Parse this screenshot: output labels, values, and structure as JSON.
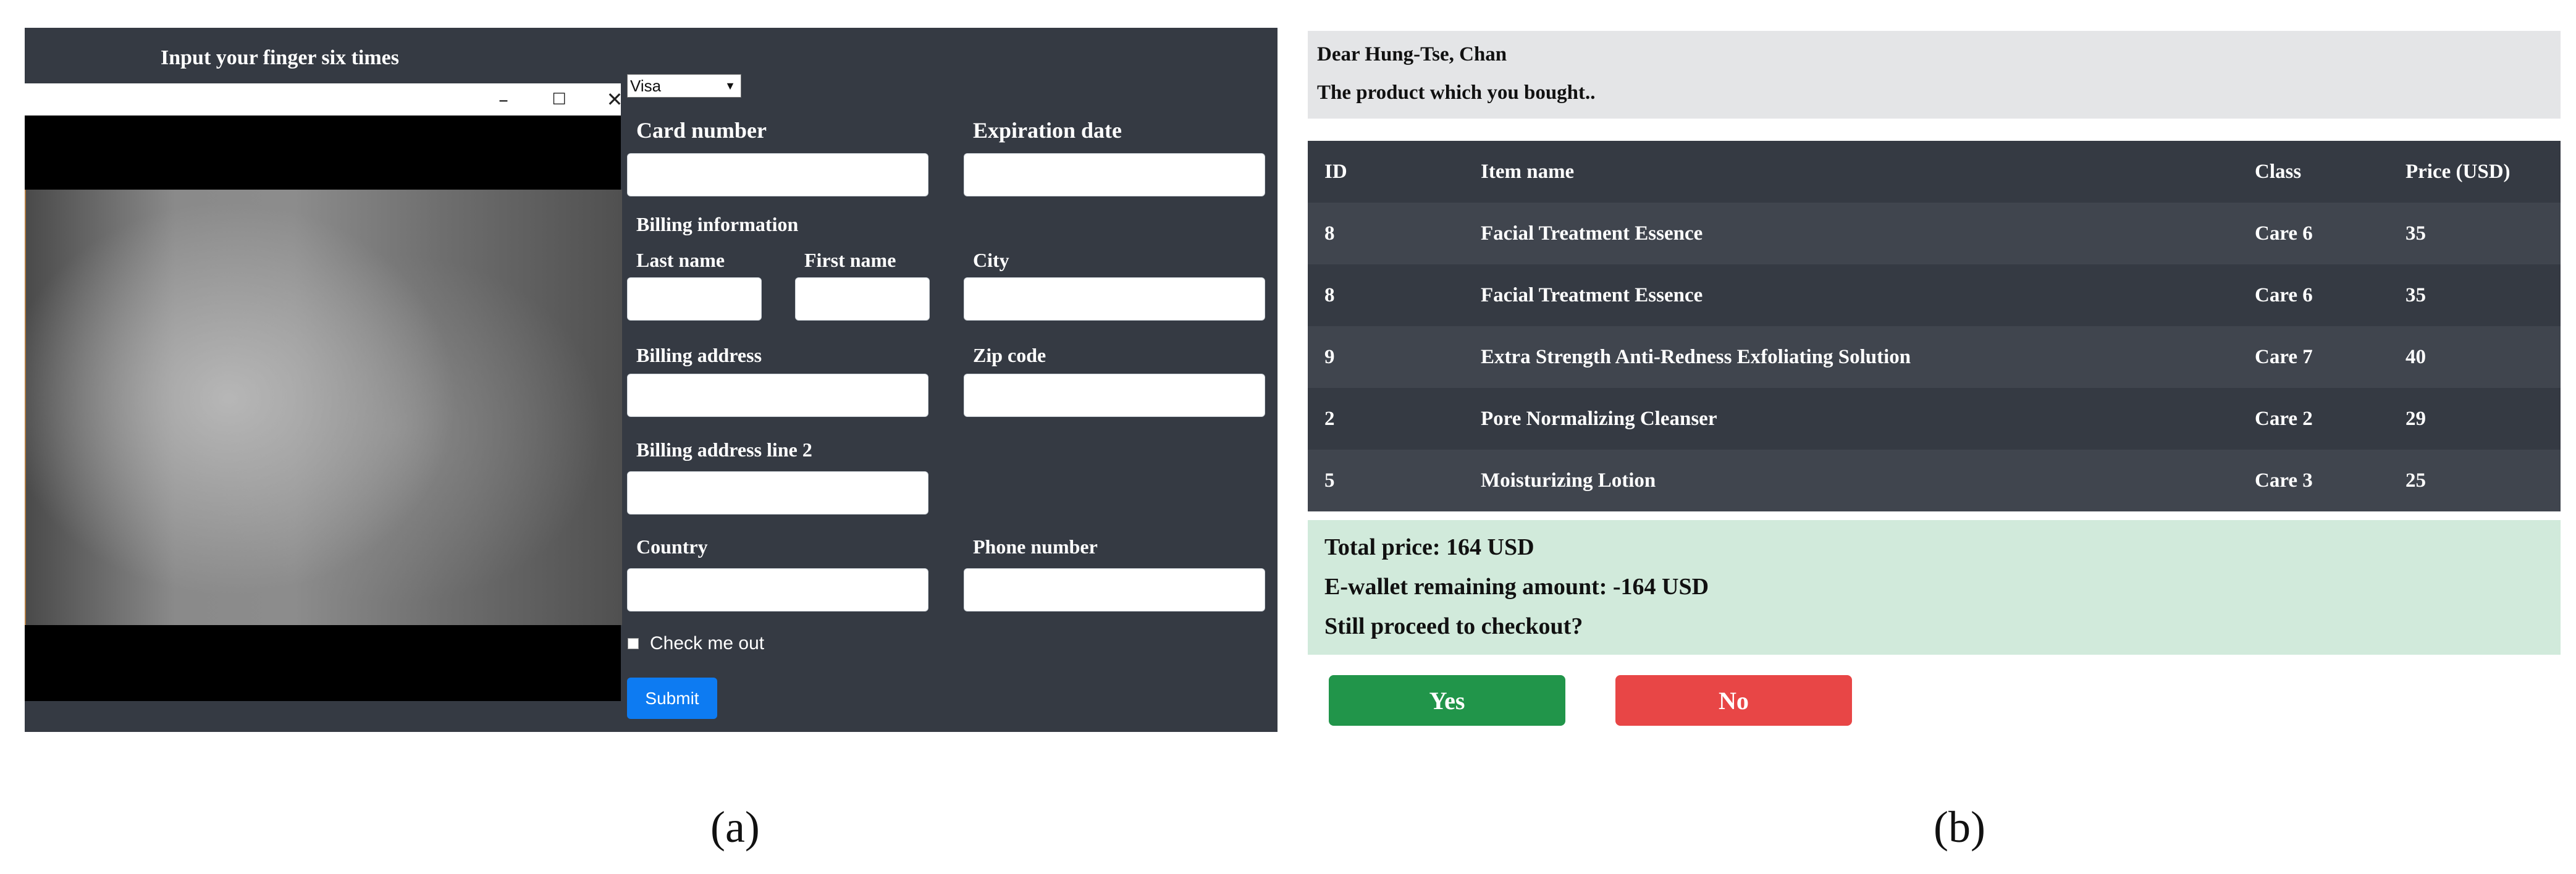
{
  "panel_a": {
    "title": "Input your finger  six times",
    "window_controls": {
      "minimize": "–",
      "maximize": "☐",
      "close": "✕"
    },
    "card_type": {
      "selected": "Visa",
      "arrow": "▼"
    },
    "labels": {
      "card_number": "Card number",
      "expiration_date": "Expiration date",
      "billing_information": "Billing information",
      "last_name": "Last name",
      "first_name": "First name",
      "city": "City",
      "billing_address": "Billing address",
      "zip_code": "Zip code",
      "billing_address_line2": "Billing address line 2",
      "country": "Country",
      "phone_number": "Phone number"
    },
    "check_label": "Check me out",
    "submit_label": "Submit",
    "caption": "(a)"
  },
  "panel_b": {
    "greeting": "Dear Hung-Tse, Chan",
    "message": "The product which you bought..",
    "table": {
      "headers": [
        "ID",
        "Item name",
        "Class",
        "Price (USD)"
      ],
      "rows": [
        [
          "8",
          "Facial Treatment Essence",
          "Care 6",
          "35"
        ],
        [
          "8",
          "Facial Treatment Essence",
          "Care 6",
          "35"
        ],
        [
          "9",
          "Extra Strength Anti-Redness Exfoliating Solution",
          "Care 7",
          "40"
        ],
        [
          "2",
          "Pore Normalizing Cleanser",
          "Care 2",
          "29"
        ],
        [
          "5",
          "Moisturizing Lotion",
          "Care 3",
          "25"
        ]
      ]
    },
    "summary": {
      "total": "Total price: 164 USD",
      "wallet": "E-wallet remaining amount: -164 USD",
      "question": "Still proceed to checkout?"
    },
    "yes_label": "Yes",
    "no_label": "No",
    "caption": "(b)"
  }
}
